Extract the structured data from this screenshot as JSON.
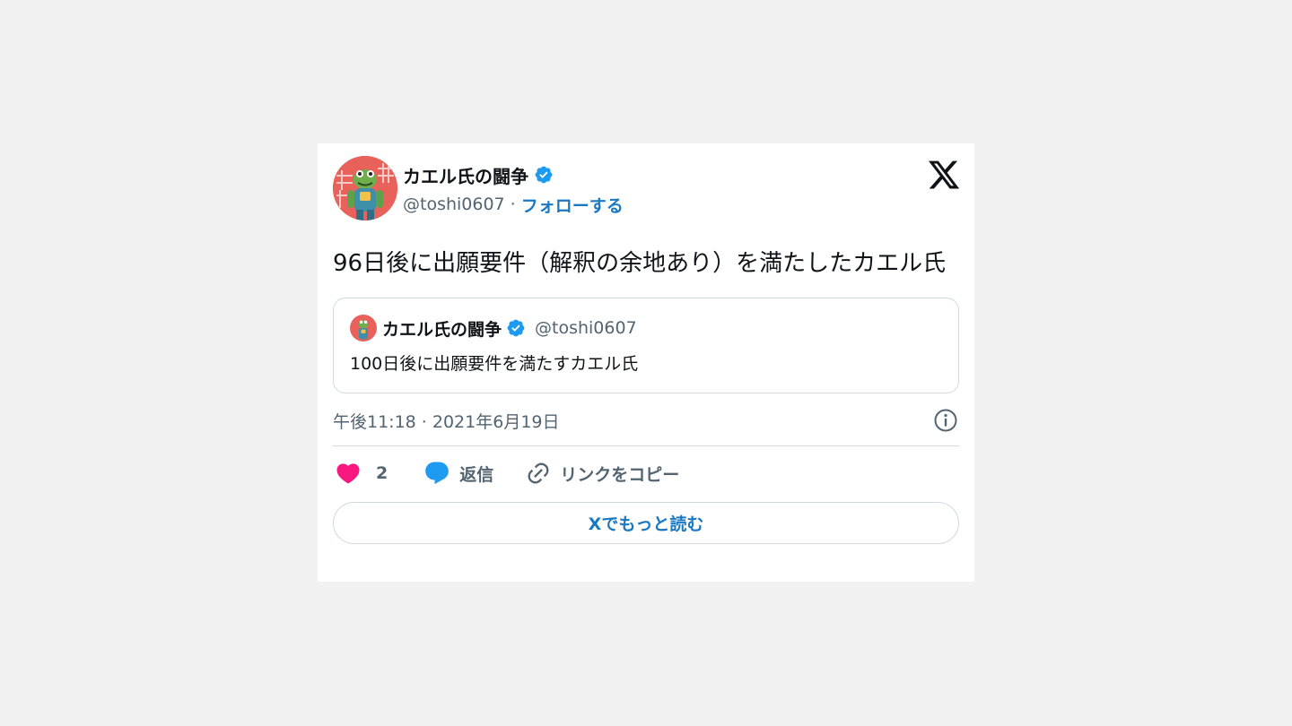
{
  "author": {
    "display_name": "カエル氏の闘争",
    "handle": "@toshi0607",
    "separator": "·",
    "follow_label": "フォローする",
    "verified": true
  },
  "tweet": {
    "text": "96日後に出願要件（解釈の余地あり）を満たしたカエル氏",
    "timestamp": "午後11:18 · 2021年6月19日"
  },
  "quoted_tweet": {
    "display_name": "カエル氏の闘争",
    "handle": "@toshi0607",
    "text": "100日後に出願要件を満たすカエル氏"
  },
  "actions": {
    "like_count": "2",
    "reply_label": "返信",
    "copy_link_label": "リンクをコピー"
  },
  "read_more_label": "Xでもっと読む",
  "icons": {
    "platform": "x-logo-icon",
    "verified": "verified-badge-icon",
    "info": "info-icon",
    "like": "heart-icon",
    "reply": "speech-bubble-icon",
    "copy": "link-icon"
  },
  "colors": {
    "accent": "#1d9bf0",
    "link_text": "#1a78c2",
    "like": "#f91880",
    "secondary_text": "#536471",
    "border": "#cfd9de",
    "background": "#f1f1f1"
  }
}
